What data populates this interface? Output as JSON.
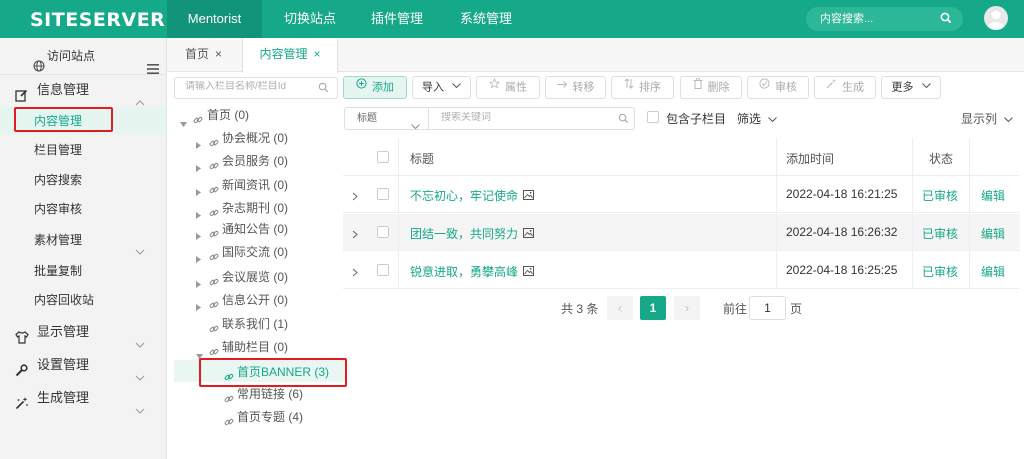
{
  "header": {
    "logo": "SITESERVER",
    "nav": [
      "Mentorist",
      "切换站点",
      "插件管理",
      "系统管理"
    ],
    "search_placeholder": "内容搜索..."
  },
  "sidebar": {
    "visit": "访问站点",
    "groups": [
      {
        "label": "信息管理",
        "items": [
          "内容管理",
          "栏目管理",
          "内容搜索",
          "内容审核",
          "素材管理",
          "批量复制",
          "内容回收站"
        ]
      },
      {
        "label": "显示管理"
      },
      {
        "label": "设置管理"
      },
      {
        "label": "生成管理"
      }
    ]
  },
  "tabs": [
    {
      "label": "首页",
      "close": "×"
    },
    {
      "label": "内容管理",
      "close": "×"
    }
  ],
  "tree": {
    "search_placeholder": "请输入栏目名称/栏目Id",
    "nodes": [
      "首页 (0)",
      "协会概况 (0)",
      "会员服务 (0)",
      "新闻资讯 (0)",
      "杂志期刊 (0)",
      "通知公告 (0)",
      "国际交流 (0)",
      "会议展览 (0)",
      "信息公开 (0)",
      "联系我们 (1)",
      "辅助栏目 (0)",
      "首页BANNER (3)",
      "常用链接 (6)",
      "首页专题 (4)"
    ]
  },
  "toolbar": {
    "add": "添加",
    "import": "导入",
    "attr": "属性",
    "move": "转移",
    "sort": "排序",
    "delete": "删除",
    "check": "审核",
    "generate": "生成",
    "more": "更多"
  },
  "filter": {
    "field": "标题",
    "keyword_placeholder": "搜索关键词",
    "include_children": "包含子栏目",
    "filter": "筛选",
    "columns": "显示列"
  },
  "table": {
    "headers": {
      "title": "标题",
      "time": "添加时间",
      "status": "状态"
    },
    "rows": [
      {
        "title": "不忘初心，牢记使命",
        "time": "2022-04-18 16:21:25",
        "status": "已审核",
        "action": "编辑"
      },
      {
        "title": "团结一致，共同努力",
        "time": "2022-04-18 16:26:32",
        "status": "已审核",
        "action": "编辑"
      },
      {
        "title": "锐意进取，勇攀高峰",
        "time": "2022-04-18 16:25:25",
        "status": "已审核",
        "action": "编辑"
      }
    ]
  },
  "pagination": {
    "total": "共 3 条",
    "current": "1",
    "prev": "‹",
    "next": "›",
    "goto_prefix": "前往",
    "goto_value": "1",
    "goto_suffix": "页"
  },
  "colors": {
    "brand": "#16a989",
    "highlight": "#e41b23"
  }
}
